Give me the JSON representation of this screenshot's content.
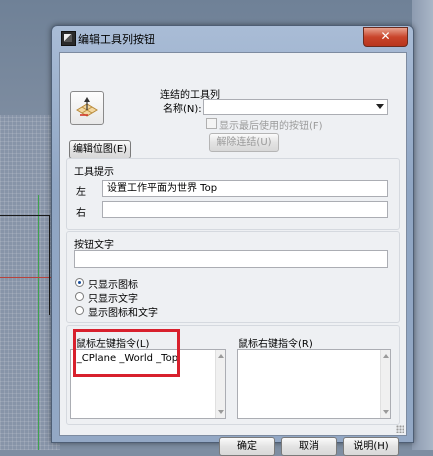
{
  "window": {
    "title": "编辑工具列按钮",
    "close_glyph": "✕"
  },
  "bitmap": {
    "icon": "cplane-world-top-icon",
    "edit_button": "编辑位图(E)"
  },
  "linked_toolbar": {
    "group_label": "连结的工具列",
    "name_label": "名称(N):",
    "name_value": "",
    "show_last_used_label": "显示最后使用的按钮(F)",
    "show_last_used_checked": false,
    "unlink_button": "解除连结(U)"
  },
  "tooltip": {
    "group_label": "工具提示",
    "left_label": "左",
    "left_value": "设置工作平面为世界 Top",
    "right_label": "右",
    "right_value": ""
  },
  "button_text": {
    "group_label": "按钮文字",
    "value": "",
    "options": [
      "只显示图标",
      "只显示文字",
      "显示图标和文字"
    ],
    "selected_index": 0
  },
  "left_command": {
    "label": "鼠标左键指令(L)",
    "value": "'_CPlane _World _Top"
  },
  "right_command": {
    "label": "鼠标右键指令(R)",
    "value": ""
  },
  "footer": {
    "ok": "确定",
    "cancel": "取消",
    "help": "说明(H)"
  },
  "colors": {
    "highlight_border": "#d8202d",
    "close_button": "#c9452b"
  }
}
